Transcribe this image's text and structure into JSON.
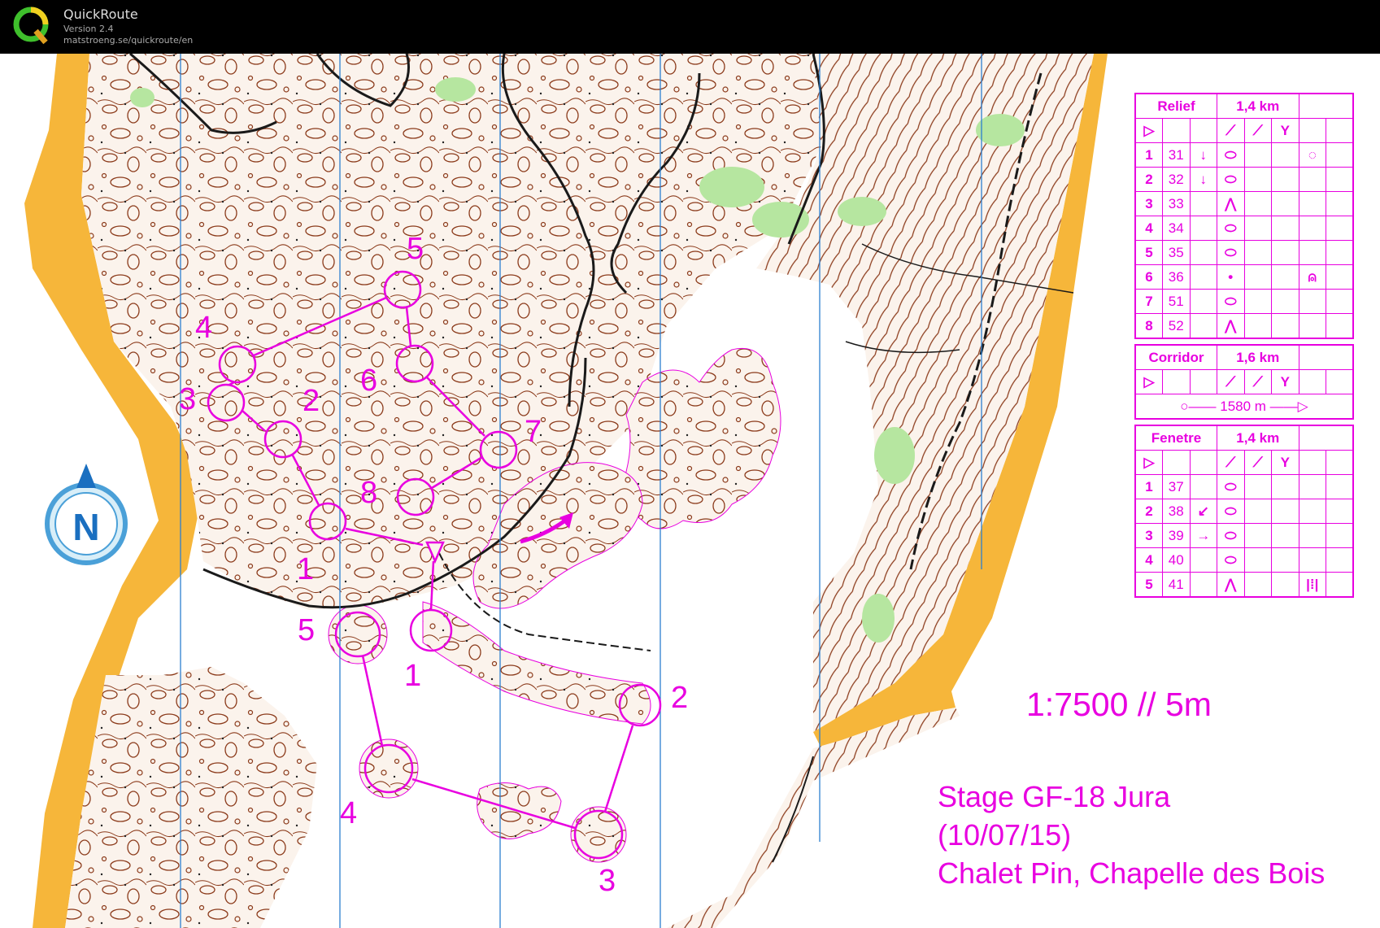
{
  "app": {
    "name": "QuickRoute",
    "version": "Version 2.4",
    "url": "matstroeng.se/quickroute/en",
    "logo_letter": "Q"
  },
  "map": {
    "north_label": "N",
    "scale": "1:7500 // 5m",
    "event_title": "Stage GF-18 Jura",
    "event_date": "(10/07/15)",
    "event_place": "Chalet Pin, Chapelle des Bois",
    "colors": {
      "course": "#e800e0",
      "contour": "#8b3a1a",
      "open": "#f6b63a",
      "vegetation": "#b6e6a0",
      "meridian": "#2c7fd0",
      "track": "#1a1a1a"
    },
    "course_numbers": [
      "1",
      "2",
      "3",
      "4",
      "5",
      "6",
      "7",
      "8",
      "5",
      "1",
      "2",
      "3",
      "4"
    ]
  },
  "legend": {
    "relief": {
      "name": "Relief",
      "length": "1,4 km",
      "controls": [
        {
          "num": "1",
          "code": "31",
          "dir": "↓",
          "feature": "⬭",
          "extra": "◌"
        },
        {
          "num": "2",
          "code": "32",
          "dir": "↓",
          "feature": "⬭",
          "extra": ""
        },
        {
          "num": "3",
          "code": "33",
          "dir": "",
          "feature": "⋀",
          "extra": ""
        },
        {
          "num": "4",
          "code": "34",
          "dir": "",
          "feature": "⬭",
          "extra": ""
        },
        {
          "num": "5",
          "code": "35",
          "dir": "",
          "feature": "⬭",
          "extra": ""
        },
        {
          "num": "6",
          "code": "36",
          "dir": "",
          "feature": "•",
          "extra": "⍝"
        },
        {
          "num": "7",
          "code": "51",
          "dir": "",
          "feature": "⬭",
          "extra": ""
        },
        {
          "num": "8",
          "code": "52",
          "dir": "",
          "feature": "⋀",
          "extra": ""
        }
      ]
    },
    "corridor": {
      "name": "Corridor",
      "length": "1,6 km",
      "finish_distance": "1580 m"
    },
    "fenetre": {
      "name": "Fenetre",
      "length": "1,4 km",
      "controls": [
        {
          "num": "1",
          "code": "37",
          "dir": "",
          "feature": "⬭",
          "extra": ""
        },
        {
          "num": "2",
          "code": "38",
          "dir": "↙",
          "feature": "⬭",
          "extra": ""
        },
        {
          "num": "3",
          "code": "39",
          "dir": "→",
          "feature": "⬭",
          "extra": ""
        },
        {
          "num": "4",
          "code": "40",
          "dir": "",
          "feature": "⬭",
          "extra": ""
        },
        {
          "num": "5",
          "code": "41",
          "dir": "",
          "feature": "⋀",
          "extra": "|⁞|"
        }
      ]
    },
    "start_symbol": "▷",
    "header_symbols": [
      "⟋",
      "⟋",
      "Y"
    ]
  }
}
